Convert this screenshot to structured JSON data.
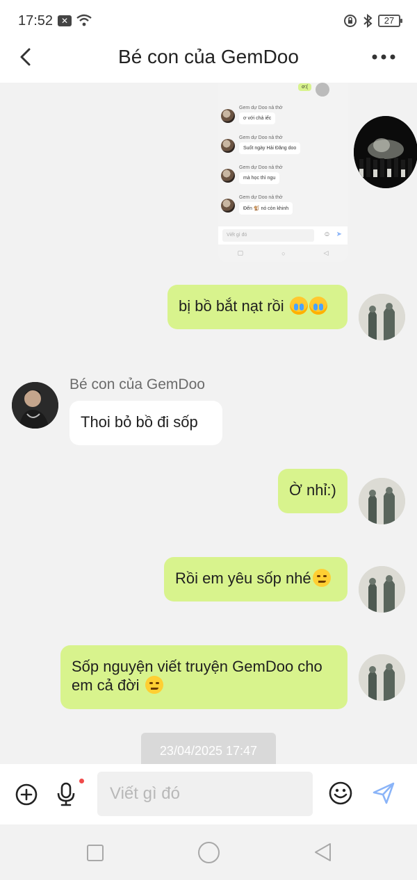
{
  "status_bar": {
    "time": "17:52",
    "notification_badge": "✕",
    "battery_level": "27"
  },
  "header": {
    "title": "Bé con của GemDoo"
  },
  "screenshot_message": {
    "top_bubble": "ơ:(",
    "messages": [
      {
        "name": "Gem dự Doo nả thở",
        "text": "ơ với chả iếc"
      },
      {
        "name": "Gem dự Doo nả thở",
        "text": "Suốt ngày Hải Đăng doo"
      },
      {
        "name": "Gem dự Doo nả thở",
        "text": "mà học thì ngu"
      },
      {
        "name": "Gem dự Doo nả thở",
        "text": "Đến 🐒 nó còn khinh"
      }
    ],
    "input_placeholder": "Viết gì đó"
  },
  "messages": [
    {
      "from": "me",
      "text": "bị bồ bắt nạt rồi"
    },
    {
      "from": "other",
      "sender_name": "Bé con của GemDoo",
      "text": "Thoi bỏ bồ đi sốp"
    },
    {
      "from": "me",
      "text": "Ờ nhỉ:)"
    },
    {
      "from": "me",
      "text": "Rồi em yêu sốp nhé"
    },
    {
      "from": "me",
      "text": "Sốp nguyện viết truyện GemDoo cho em cả đời"
    }
  ],
  "date_divider": "23/04/2025 17:47",
  "composer": {
    "placeholder": "Viết gì đó"
  },
  "colors": {
    "my_bubble": "#d8f38d",
    "other_bubble": "#ffffff",
    "send_icon": "#8ab4f8",
    "mic_dot": "#f04a4a"
  },
  "icons": [
    "back-icon",
    "more-icon",
    "plus-circle-icon",
    "mic-icon",
    "emoji-icon",
    "send-icon",
    "nav-recents-icon",
    "nav-home-icon",
    "nav-back-icon"
  ]
}
